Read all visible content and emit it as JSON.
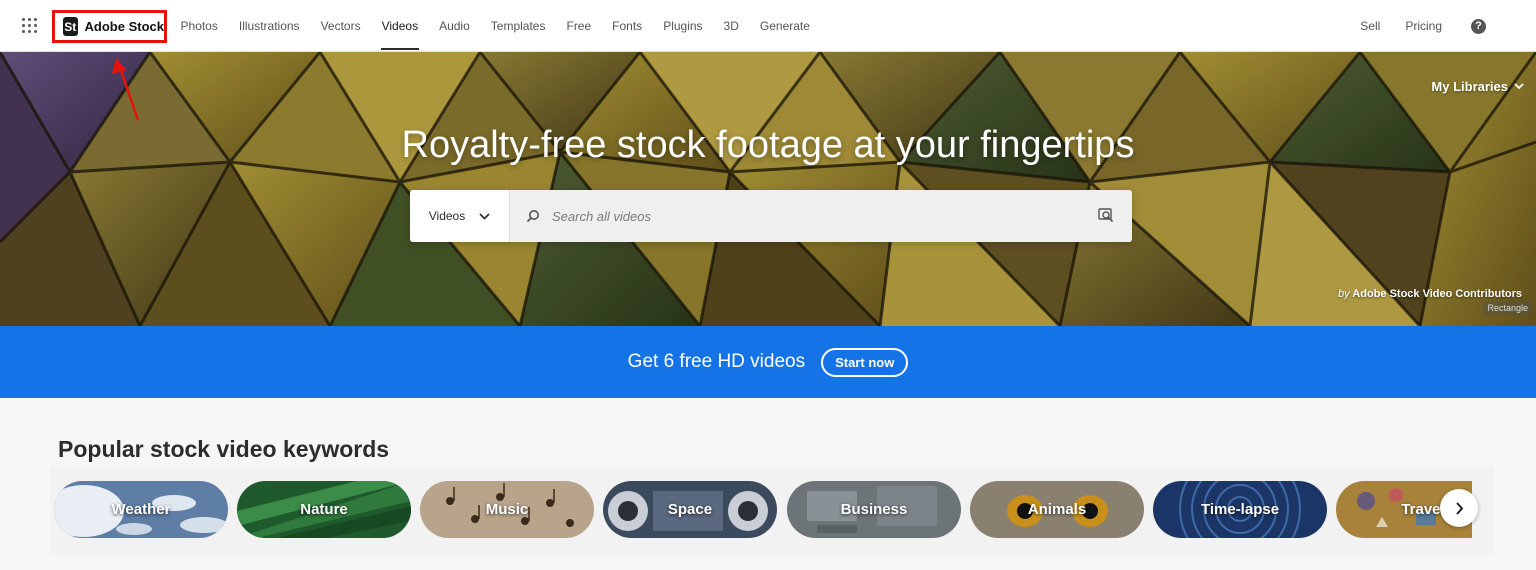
{
  "brand": {
    "badge": "St",
    "name": "Adobe Stock"
  },
  "nav": {
    "items": [
      {
        "label": "Photos",
        "active": false
      },
      {
        "label": "Illustrations",
        "active": false
      },
      {
        "label": "Vectors",
        "active": false
      },
      {
        "label": "Videos",
        "active": true
      },
      {
        "label": "Audio",
        "active": false
      },
      {
        "label": "Templates",
        "active": false
      },
      {
        "label": "Free",
        "active": false
      },
      {
        "label": "Fonts",
        "active": false
      },
      {
        "label": "Plugins",
        "active": false
      },
      {
        "label": "3D",
        "active": false
      },
      {
        "label": "Generate",
        "active": false
      }
    ],
    "right": {
      "sell": "Sell",
      "pricing": "Pricing",
      "help": "?"
    }
  },
  "hero": {
    "libraries": "My Libraries",
    "title": "Royalty-free stock footage at your fingertips",
    "search": {
      "type": "Videos",
      "placeholder": "Search all videos"
    },
    "credit_by": "by",
    "credit_name": "Adobe Stock Video Contributors",
    "rect_label": "Rectangle"
  },
  "promo": {
    "text": "Get 6 free HD videos",
    "button": "Start now"
  },
  "keywords": {
    "title": "Popular stock video keywords",
    "items": [
      "Weather",
      "Nature",
      "Music",
      "Space",
      "Business",
      "Animals",
      "Time-lapse",
      "Travel"
    ]
  },
  "colors": {
    "accent": "#1473e6",
    "annotation": "#e8120c"
  }
}
